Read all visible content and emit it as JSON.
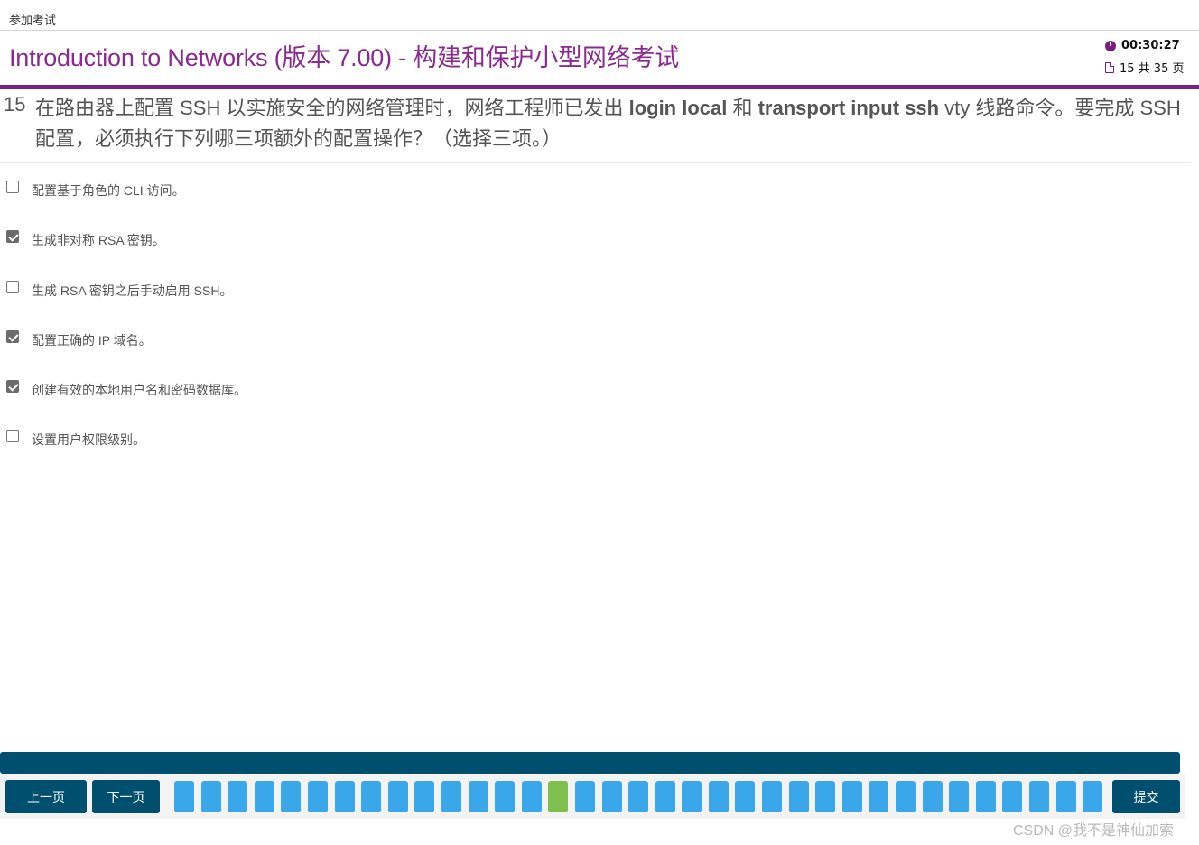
{
  "window": {
    "title": "参加考试"
  },
  "header": {
    "title": "Introduction to Networks (版本 7.00) - 构建和保护小型网络考试",
    "timer": "00:30:27",
    "page_indicator": "15 共 35 页"
  },
  "question": {
    "number": "15",
    "text_part1": "在路由器上配置 SSH 以实施安全的网络管理时，网络工程师已发出 ",
    "cmd1": "login local",
    "text_part2": " 和 ",
    "cmd2": "transport input ssh",
    "text_part3": " vty 线路命令。要完成 SSH 配置，必须执行下列哪三项额外的配置操作？（选择三项。）"
  },
  "options": [
    {
      "label": "配置基于角色的 CLI 访问。",
      "checked": false
    },
    {
      "label": "生成非对称 RSA 密钥。",
      "checked": true
    },
    {
      "label": "生成 RSA 密钥之后手动启用 SSH。",
      "checked": false
    },
    {
      "label": "配置正确的 IP 域名。",
      "checked": true
    },
    {
      "label": "创建有效的本地用户名和密码数据库。",
      "checked": true
    },
    {
      "label": "设置用户权限级别。",
      "checked": false
    }
  ],
  "nav": {
    "prev_label": "上一页",
    "next_label": "下一页",
    "submit_label": "提交",
    "total_cells": 35,
    "current_cell": 15,
    "cell_color": "#3aa7ea",
    "current_color": "#7fbf4d"
  },
  "colors": {
    "brand_purple": "#8a2a8e",
    "nav_dark": "#004f6e"
  },
  "watermark": "CSDN @我不是神仙加索"
}
